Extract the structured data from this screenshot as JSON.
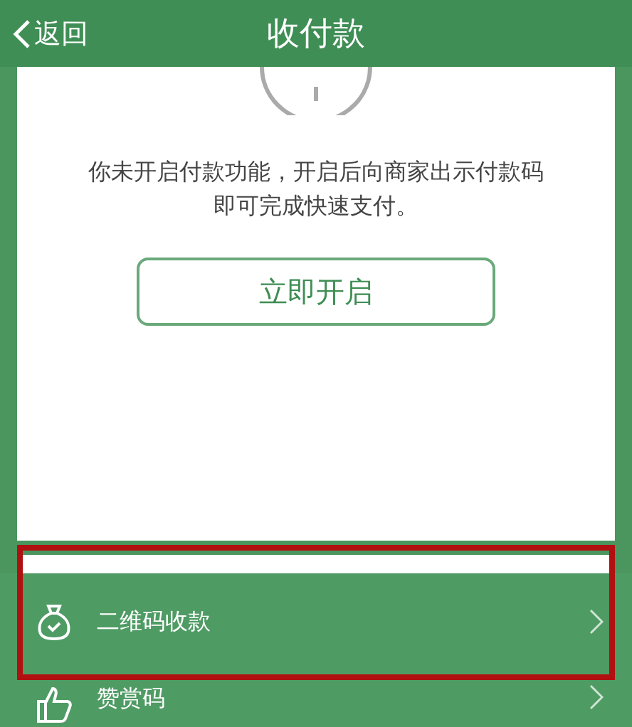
{
  "nav_bar": {
    "back_label": "返回",
    "title": "收付款"
  },
  "payment_card": {
    "message": "你未开启付款功能，开启后向商家出示付款码即可完成快速支付。",
    "button": "立即开启"
  },
  "menu": [
    {
      "kind": "receive",
      "label": "二维码收款",
      "highlighted": true
    },
    {
      "kind": "reward",
      "label": "赞赏码",
      "highlighted": false
    }
  ]
}
